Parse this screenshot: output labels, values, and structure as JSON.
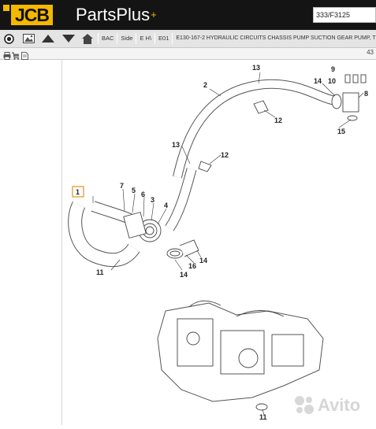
{
  "header": {
    "logo_text": "JCB",
    "brand": "PartsPlus",
    "brand_mark": "+",
    "search_value": "333/F3125"
  },
  "toolbar": {
    "icons": [
      "compass-icon",
      "image-icon",
      "arrow-up-icon",
      "arrow-down-icon",
      "home-icon"
    ],
    "crumbs": [
      "BAC",
      "Side",
      "E H\\",
      "E01"
    ],
    "title": "E130-167-2 HYDRAULIC CIRCUITS CHASSIS PUMP SUCTION GEAR PUMP, T"
  },
  "subbar": {
    "icons": [
      "print-icon",
      "cart-icon",
      "document-icon"
    ],
    "page": "43"
  },
  "diagram": {
    "selected_callout": "1",
    "callouts": [
      "1",
      "2",
      "3",
      "4",
      "5",
      "6",
      "7",
      "8",
      "9",
      "10",
      "11",
      "11",
      "12",
      "12",
      "13",
      "13",
      "14",
      "14",
      "14",
      "15",
      "16"
    ]
  },
  "watermark": "Avito",
  "colors": {
    "header_bg": "#141414",
    "brand_yellow": "#f5b800",
    "highlight": "#e8a13a"
  }
}
